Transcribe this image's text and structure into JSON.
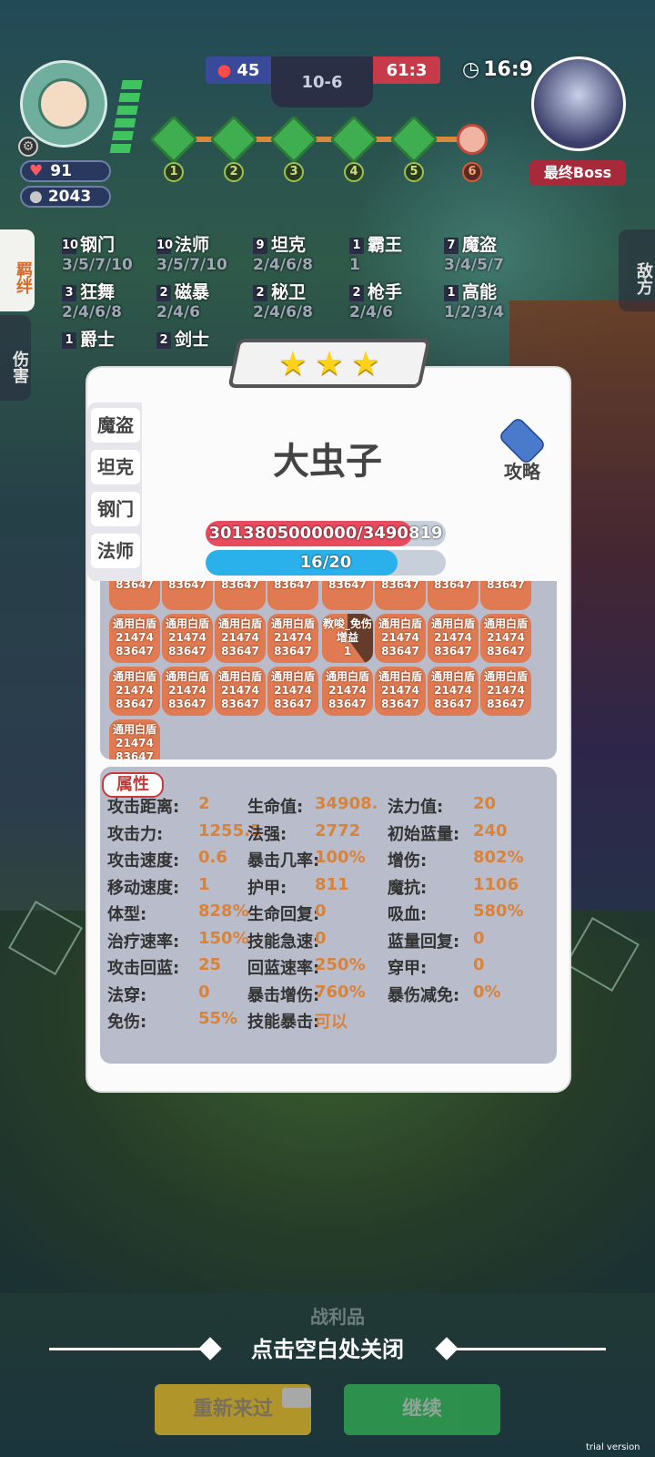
{
  "hud": {
    "player_hp": "91",
    "player_gold": "2043",
    "score_left": "45",
    "stage": "10-6",
    "score_right": "61:3",
    "timer": "16:9",
    "boss_label": "最终Boss",
    "path_nodes": [
      "1",
      "2",
      "3",
      "4",
      "5",
      "6"
    ]
  },
  "side_tabs": {
    "left_active": "羁绊",
    "left_inactive": "伤害",
    "right": "敌方"
  },
  "synergies": [
    {
      "count": "10",
      "name": "钢门",
      "tiers": "3/5/7/10"
    },
    {
      "count": "10",
      "name": "法师",
      "tiers": "3/5/7/10"
    },
    {
      "count": "9",
      "name": "坦克",
      "tiers": "2/4/6/8"
    },
    {
      "count": "1",
      "name": "霸王",
      "tiers": "1"
    },
    {
      "count": "7",
      "name": "魔盗",
      "tiers": "3/4/5/7"
    },
    {
      "count": "3",
      "name": "狂舞",
      "tiers": "2/4/6/8"
    },
    {
      "count": "2",
      "name": "磁暴",
      "tiers": "2/4/6"
    },
    {
      "count": "2",
      "name": "秘卫",
      "tiers": "2/4/6/8"
    },
    {
      "count": "2",
      "name": "枪手",
      "tiers": "2/4/6"
    },
    {
      "count": "1",
      "name": "高能",
      "tiers": "1/2/3/4"
    },
    {
      "count": "1",
      "name": "爵士",
      "tiers": ""
    },
    {
      "count": "2",
      "name": "剑士",
      "tiers": ""
    }
  ],
  "modal": {
    "stars": 3,
    "class_tabs": [
      "魔盗",
      "坦克",
      "钢门",
      "法师"
    ],
    "unit_name": "大虫子",
    "guide_label": "攻略",
    "hp_text": "3013805000000/3490819",
    "hp_fraction": 0.86,
    "mana_text": "16/20",
    "mana_fraction": 0.8,
    "buffs": {
      "common_label": "通用白盾",
      "common_value": "21474 83647",
      "special_label": "教唆_免伤增益",
      "special_value": "1"
    },
    "attr_title": "属性",
    "attributes": [
      {
        "label": "攻击距离:",
        "value": "2"
      },
      {
        "label": "生命值:",
        "value": "34908."
      },
      {
        "label": "法力值:",
        "value": "20"
      },
      {
        "label": "攻击力:",
        "value": "1255.5"
      },
      {
        "label": "法强:",
        "value": "2772"
      },
      {
        "label": "初始蓝量:",
        "value": "240"
      },
      {
        "label": "攻击速度:",
        "value": "0.6"
      },
      {
        "label": "暴击几率:",
        "value": "100%"
      },
      {
        "label": "增伤:",
        "value": "802%"
      },
      {
        "label": "移动速度:",
        "value": "1"
      },
      {
        "label": "护甲:",
        "value": "811"
      },
      {
        "label": "魔抗:",
        "value": "1106"
      },
      {
        "label": "体型:",
        "value": "828%"
      },
      {
        "label": "生命回复:",
        "value": "0"
      },
      {
        "label": "吸血:",
        "value": "580%"
      },
      {
        "label": "治疗速率:",
        "value": "150%"
      },
      {
        "label": "技能急速:",
        "value": "0"
      },
      {
        "label": "蓝量回复:",
        "value": "0"
      },
      {
        "label": "攻击回蓝:",
        "value": "25"
      },
      {
        "label": "回蓝速率:",
        "value": "250%"
      },
      {
        "label": "穿甲:",
        "value": "0"
      },
      {
        "label": "法穿:",
        "value": "0"
      },
      {
        "label": "暴击增伤:",
        "value": "760%"
      },
      {
        "label": "暴伤减免:",
        "value": "0%"
      },
      {
        "label": "免伤:",
        "value": "55%"
      },
      {
        "label": "技能暴击:",
        "value": "可以"
      }
    ]
  },
  "bottom": {
    "close_hint": "点击空白处关闭",
    "spoils_label": "战利品",
    "retry_label": "重新来过",
    "continue_label": "继续",
    "watermark": "trial version"
  }
}
